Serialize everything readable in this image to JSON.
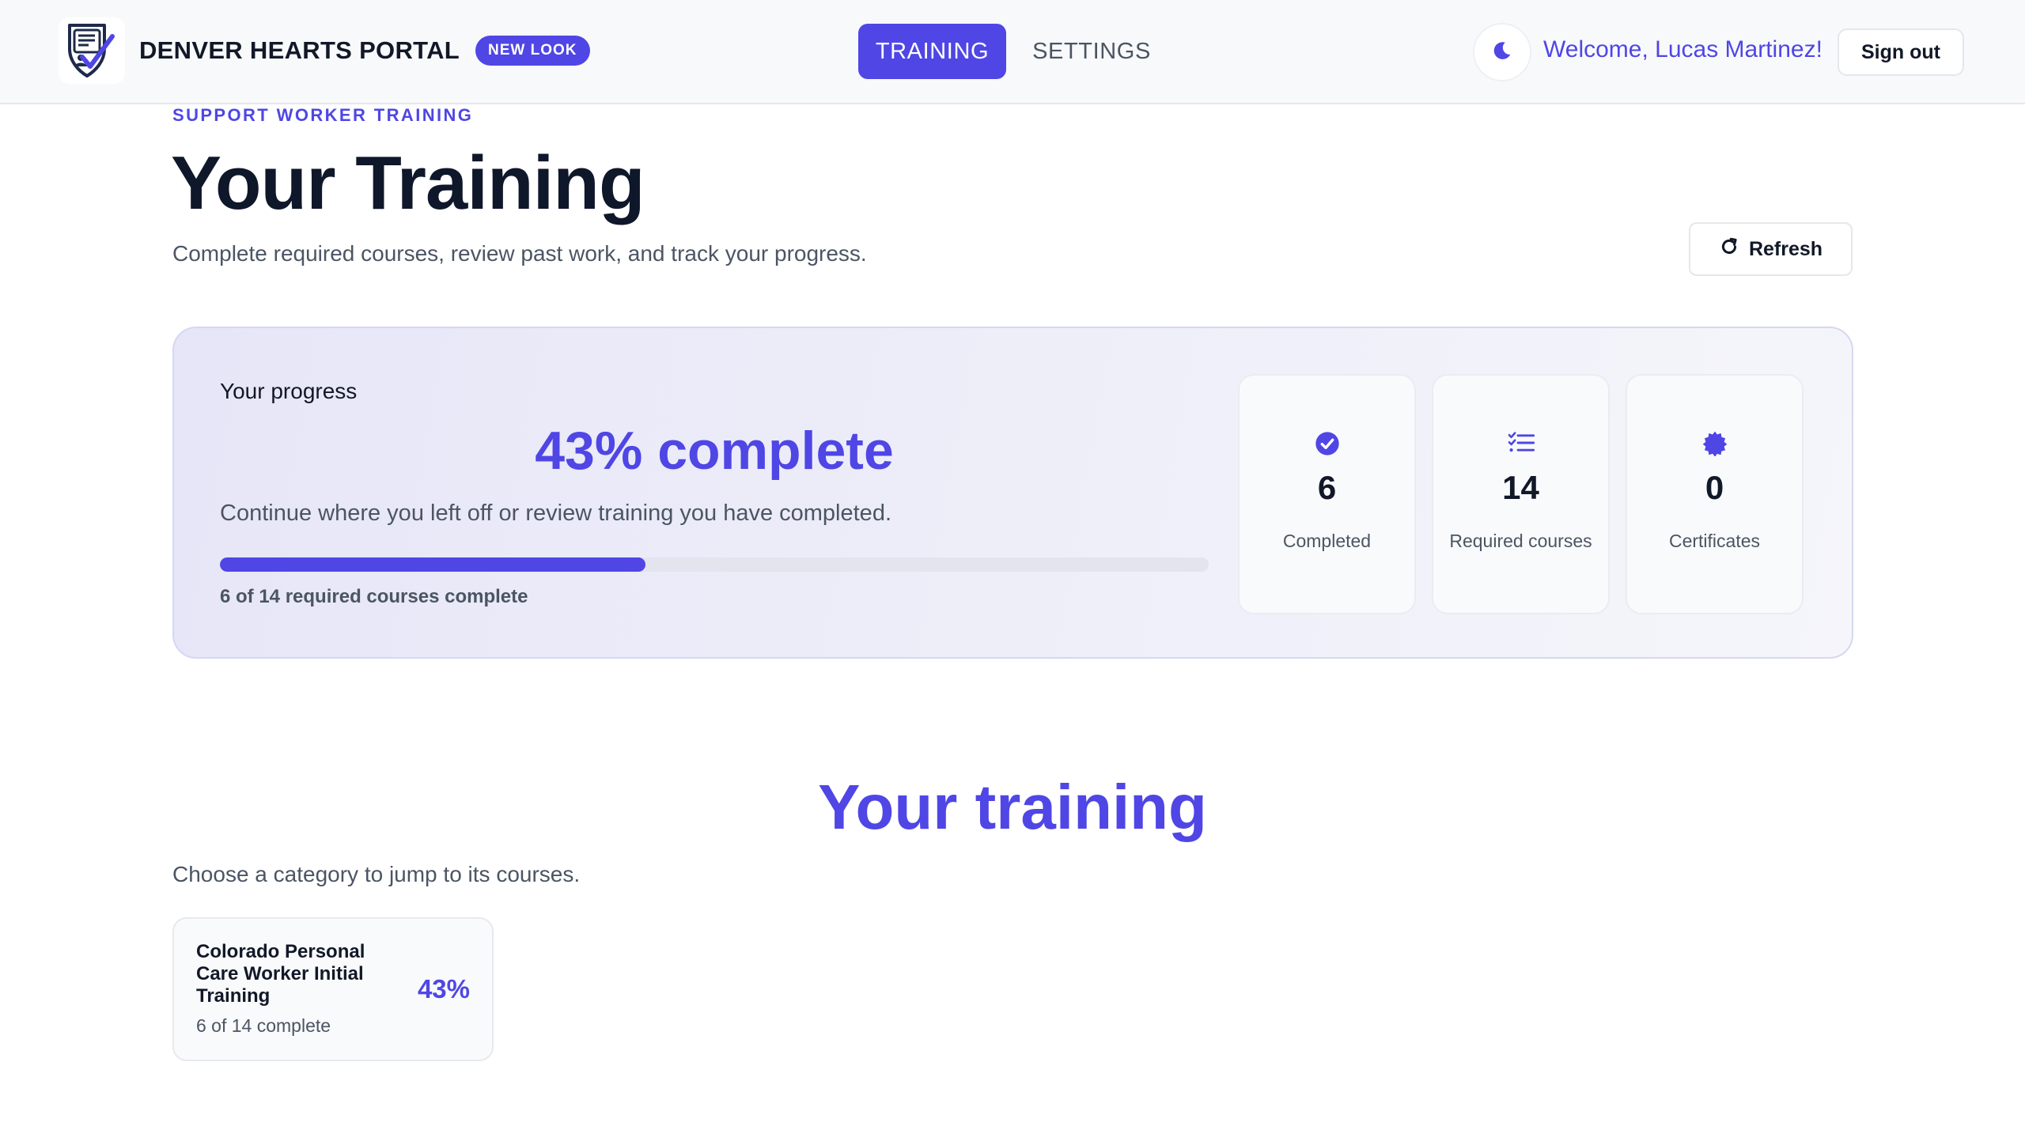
{
  "header": {
    "brand_name": "DENVER HEARTS PORTAL",
    "badge": "NEW LOOK",
    "nav": {
      "training": "TRAINING",
      "settings": "SETTINGS"
    },
    "welcome": "Welcome, Lucas Martinez!",
    "sign_out": "Sign out",
    "icons": {
      "logo": "shield-checklist-logo",
      "theme": "moon-icon"
    }
  },
  "page": {
    "eyebrow": "SUPPORT WORKER TRAINING",
    "title": "Your Training",
    "subtitle": "Complete required courses, review past work, and track your progress.",
    "refresh": "Refresh"
  },
  "progress": {
    "label": "Your progress",
    "percent_text": "43% complete",
    "description": "Continue where you left off or review training you have completed.",
    "fraction": 0.43,
    "caption": "6 of 14 required courses complete",
    "stats": [
      {
        "icon": "check-circle-icon",
        "value": "6",
        "label": "Completed"
      },
      {
        "icon": "checklist-icon",
        "value": "14",
        "label": "Required courses"
      },
      {
        "icon": "badge-icon",
        "value": "0",
        "label": "Certificates"
      }
    ]
  },
  "training": {
    "title": "Your training",
    "subtitle": "Choose a category to jump to its courses.",
    "categories": [
      {
        "title": "Colorado Personal Care Worker Initial Training",
        "meta": "6 of 14 complete",
        "percent": "43%"
      }
    ]
  },
  "colors": {
    "accent": "#4f46e5",
    "text": "#111827",
    "muted": "#4b5563"
  }
}
